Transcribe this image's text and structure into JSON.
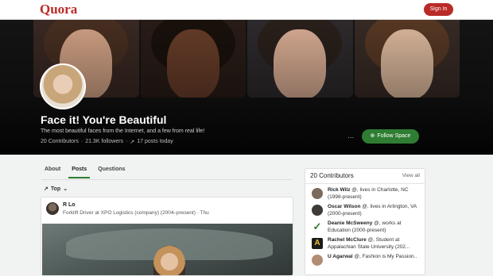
{
  "header": {
    "logo": "Quora",
    "signin_label": "Sign In"
  },
  "space": {
    "title": "Face it! You're Beautiful",
    "description": "The most beautiful faces from the Internet, and a few from real life!",
    "contributors": "20 Contributors",
    "dot1": "·",
    "followers": "21.3K followers",
    "dot2": "·",
    "posts_today": "17 posts today",
    "follow_label": "Follow Space",
    "more_icon": "..."
  },
  "tabs": [
    {
      "label": "About"
    },
    {
      "label": "Posts"
    },
    {
      "label": "Questions"
    }
  ],
  "sort": {
    "label": "Top"
  },
  "post": {
    "author": "R Lo",
    "credential": "Forklift Driver at XPO Logistics (company) (2004–present) · Thu"
  },
  "contributors_panel": {
    "title": "20 Contributors",
    "view_all": "View all",
    "items": [
      {
        "name": "Rick Wilz",
        "detail": " @, lives in Charlotte, NC (1998-present)"
      },
      {
        "name": "Oscar Wilson",
        "detail": " @, lives in Arlington, VA (2000-present)"
      },
      {
        "name": "Deanie McSweeny",
        "detail": " @, works at Education (2000-present)"
      },
      {
        "name": "Rachel McClure",
        "detail": " @, Student at Appalachian State University (202..."
      },
      {
        "name": "U Agarwal",
        "detail": " @, Fashion is My Passion.."
      }
    ]
  },
  "colors": {
    "brand": "#b92b27",
    "follow": "#2e7d32"
  }
}
